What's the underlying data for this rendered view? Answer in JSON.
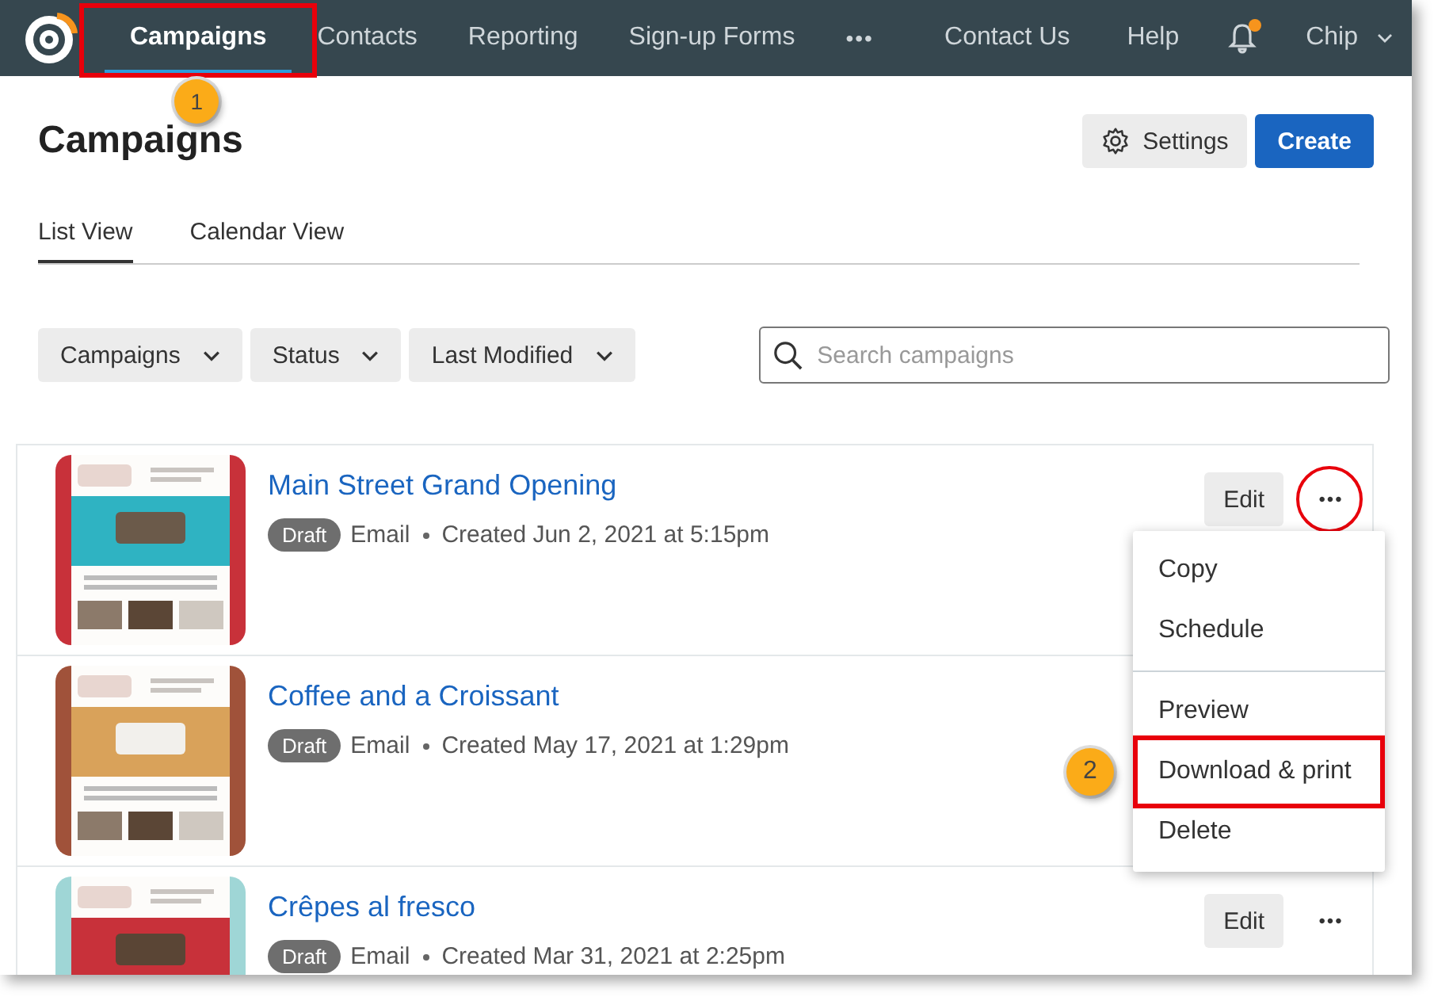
{
  "nav": {
    "items": [
      {
        "label": "Campaigns",
        "selected": true,
        "annotated": true,
        "callout": "1"
      },
      {
        "label": "Contacts",
        "selected": false,
        "annotated": false
      },
      {
        "label": "Reporting",
        "selected": false,
        "annotated": false
      },
      {
        "label": "Sign-up Forms",
        "selected": false,
        "annotated": false
      }
    ],
    "more": "•••",
    "links": [
      "Contact Us",
      "Help"
    ],
    "notifications_unread": true,
    "user": "Chip"
  },
  "page_title": "Campaigns",
  "header_buttons": {
    "settings": "Settings",
    "create": "Create"
  },
  "view_tabs": [
    {
      "label": "List View",
      "selected": true
    },
    {
      "label": "Calendar View",
      "selected": false
    }
  ],
  "filters": [
    "Campaigns",
    "Status",
    "Last Modified"
  ],
  "search": {
    "placeholder": "Search campaigns"
  },
  "campaigns": [
    {
      "title": "Main Street Grand Opening",
      "status": "Draft",
      "type": "Email",
      "created": "Created Jun 2, 2021 at 5:15pm",
      "edit": "Edit",
      "more": "•••",
      "menu_open": true,
      "annotated": true
    },
    {
      "title": "Coffee and a Croissant",
      "status": "Draft",
      "type": "Email",
      "created": "Created May 17, 2021 at 1:29pm"
    },
    {
      "title": "Crêpes al fresco",
      "status": "Draft",
      "type": "Email",
      "created": "Created Mar 31, 2021 at 2:25pm",
      "edit": "Edit",
      "more": "•••",
      "annotated": false
    }
  ],
  "menu": {
    "groups": [
      [
        {
          "label": "Copy",
          "annotated": false
        },
        {
          "label": "Schedule",
          "annotated": false
        }
      ],
      [
        {
          "label": "Preview",
          "annotated": false
        },
        {
          "label": "Download & print",
          "annotated": true,
          "callout": "2"
        },
        {
          "label": "Delete",
          "annotated": false
        }
      ]
    ]
  }
}
